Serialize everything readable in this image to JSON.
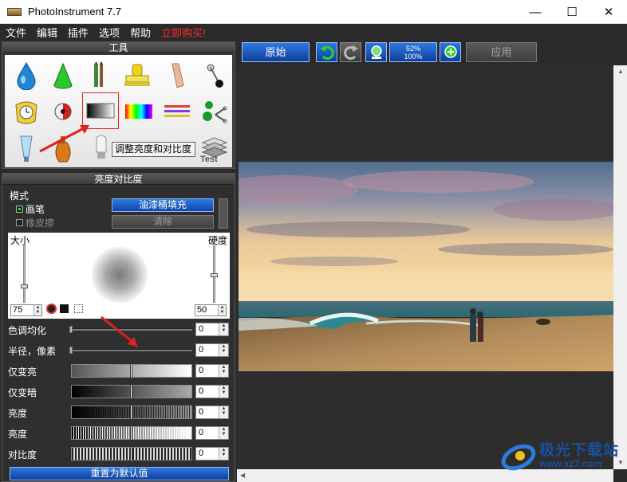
{
  "window": {
    "title": "PhotoInstrument 7.7",
    "minimize": "—",
    "maximize": "☐",
    "close": "✕"
  },
  "menu": [
    "文件",
    "编辑",
    "插件",
    "选项",
    "帮助",
    "立即购买!"
  ],
  "tools_panel": {
    "title": "工具",
    "tools": [
      "water-drop-icon",
      "cone-icon",
      "brushes-icon",
      "stamp-icon",
      "finger-icon",
      "pin-icon",
      "clock-icon",
      "eye-icon",
      "gradient-icon",
      "rainbow-icon",
      "lines-icon",
      "scissors-icon",
      "tube-icon",
      "vase-icon",
      "bulb-icon",
      "stack-icon"
    ],
    "tooltip": "调整亮度和对比度",
    "stack_label": "Test"
  },
  "bc_panel": {
    "title": "亮度对比度",
    "mode_label": "模式",
    "brush_option": "画笔",
    "eraser_option": "橡皮擦",
    "fill_button": "油漆桶填充",
    "clear_button": "清除",
    "size_label": "大小",
    "hardness_label": "硬度",
    "size_value": "75",
    "hardness_value": "50",
    "params": [
      {
        "label": "色调均化",
        "value": "0"
      },
      {
        "label": "半径，像素",
        "value": "0"
      },
      {
        "label": "仅变亮",
        "value": "0"
      },
      {
        "label": "仅变暗",
        "value": "0"
      },
      {
        "label": "亮度",
        "value": "0"
      },
      {
        "label": "亮度",
        "value": "0"
      },
      {
        "label": "对比度",
        "value": "0"
      }
    ],
    "reset_button": "重置为默认值"
  },
  "toolbar": {
    "original_button": "原始",
    "zoom_percent": "52%",
    "zoom_full": "100%",
    "apply_button": "应用"
  },
  "watermark": {
    "title": "极光下载站",
    "url": "www.xz7.com"
  },
  "colors": {
    "accent_blue": "#1f5fcf",
    "buy_red": "#ff2a2a",
    "annotation_red": "#e02020"
  }
}
